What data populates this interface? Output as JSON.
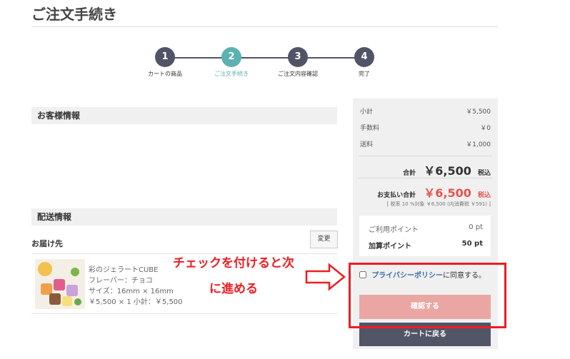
{
  "page": {
    "title": "ご注文手続き"
  },
  "stepper": {
    "steps": [
      {
        "number": "1",
        "label": "カートの商品"
      },
      {
        "number": "2",
        "label": "ご注文手続き"
      },
      {
        "number": "3",
        "label": "ご注文内容確認"
      },
      {
        "number": "4",
        "label": "完了"
      }
    ],
    "active_step": 2
  },
  "customer": {
    "heading": "お客様情報"
  },
  "delivery": {
    "heading": "配送情報",
    "destination_label": "お届け先",
    "change_label": "変更",
    "item": {
      "name": "彩のジェラートCUBE",
      "flavor": "フレーバー：チョコ",
      "size": "サイズ：16mm × 16mm",
      "price_line": "￥5,500 × 1  小計：￥5,500"
    }
  },
  "summary": {
    "subtotal_label": "小計",
    "subtotal_value": "￥5,500",
    "fee_label": "手数料",
    "fee_value": "￥0",
    "shipping_label": "送料",
    "shipping_value": "￥1,000",
    "total_label": "合計",
    "total_amount": "￥6,500",
    "total_tax": "税込",
    "pay_label": "お支払い合計",
    "pay_amount": "￥6,500",
    "pay_tax": "税込",
    "tax_note": "[ 税率 10 %対象 ￥6,500 (内消費税 ￥591) ]"
  },
  "points": {
    "use_label": "ご利用ポイント",
    "use_value": "0 pt",
    "add_label": "加算ポイント",
    "add_value": "50 pt"
  },
  "privacy": {
    "link_text": "プライバシーポリシー",
    "suffix": "に同意する。",
    "checked": false
  },
  "buttons": {
    "confirm_label": "確認する",
    "back_label": "カートに戻る"
  },
  "annotation": {
    "line1": "チェックを付けると次",
    "line2": "に進める"
  },
  "colors": {
    "accent_teal": "#5cb1b1",
    "step_dark": "#515466",
    "price_red": "#e4534f",
    "annotation_red": "#ee1d23",
    "confirm_pink": "#e9a6a3"
  }
}
